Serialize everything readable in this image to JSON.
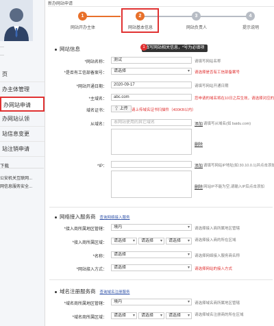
{
  "sidebar": {
    "items": [
      {
        "label": "页"
      },
      {
        "label": "办主体管理"
      },
      {
        "label": "办网站申请"
      },
      {
        "label": "办网站认领"
      },
      {
        "label": "站信息变更"
      },
      {
        "label": "站注销申请"
      }
    ],
    "download_title": "下载",
    "download_links": [
      "公安机关互联网...",
      "网信息服务安全..."
    ]
  },
  "header": {
    "breadcrumb": "新办网站申请"
  },
  "steps": [
    {
      "num": "1",
      "label": "网站开办主体"
    },
    {
      "num": "2",
      "label": "网站基本信息"
    },
    {
      "num": "3",
      "label": "网站负责人"
    },
    {
      "num": "4",
      "label": "提示说明"
    }
  ],
  "tip": {
    "num": "1",
    "text": "填写网站相关信息，*号为必填项"
  },
  "site_info": {
    "title": "网站信息",
    "name_label": "*网站名称：",
    "name_value": "测试",
    "name_hint": "请填写网站名称",
    "preapproval_label": "*是否有工信部备案号：",
    "preapproval_value": "请选择",
    "preapproval_hint": "请选择是否有工信部备案号",
    "open_date_label": "*网站开通日期：",
    "open_date_value": "2020-09-17",
    "open_date_hint": "请填写网站开通日期",
    "domain_label": "*主域名：",
    "domain_value": "abc.com",
    "domain_hint": "您申请的域名将在10日之后生效，请选择对应的",
    "cert_label": "域名证书：",
    "cert_button": "上传",
    "cert_hint": "请上传域名证书扫描件（400KB以内）",
    "sub_domain_label": "从域名：",
    "sub_domain_placeholder": "本网站使用的其它域名",
    "sub_domain_add": "添加",
    "sub_domain_hint": "请填写从域名(如 baidu.com)",
    "delete1": "删除",
    "ip_label": "*IP：",
    "ip_add": "添加",
    "ip_hint": "请填写网站IP地址(如:30.10.0.1)并点击添加",
    "delete2": "删除",
    "ip_hint2": "网站IP不能为空,请输入IP后点击添加"
  },
  "isp": {
    "title": "网络接入服务商",
    "link": "查询网络接入服务",
    "region_label": "*接入商所属地区管辖：",
    "region_value": "境内",
    "region_hint": "请选择接入商所属地区管辖",
    "area_label": "*接入商所属区域：",
    "area_values": [
      "请选择",
      "请选择",
      "请选择"
    ],
    "area_hint": "请选择接入商的所在区域",
    "name_label": "*名称：",
    "name_value": "请选择",
    "name_hint": "请选择网络接入服务商名称",
    "method_label": "*网站接入方式：",
    "method_value": "请选择",
    "method_hint": "请选择网站的接入方式"
  },
  "registrar": {
    "title": "域名注册服务商",
    "link": "查询域名注册服务",
    "region_label": "*域名商所属地区管辖：",
    "region_value": "境内",
    "region_hint": "请选择域名商所属地区管辖",
    "area_label": "*域名商所属区域：",
    "area_values": [
      "请选择",
      "请选择",
      "请选择"
    ],
    "area_hint": "请选择域名注册商的所在区域"
  },
  "colors": {
    "accent": "#e8702a",
    "active_step": "#e03030",
    "inactive_step": "#b7bcc4",
    "highlight": "#e03030"
  }
}
